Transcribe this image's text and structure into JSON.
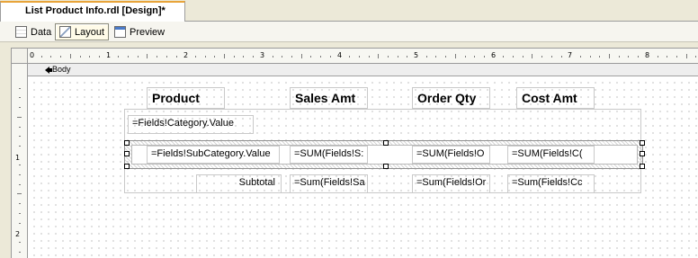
{
  "document_tab": {
    "title": "List Product Info.rdl [Design]*"
  },
  "view_tabs": [
    {
      "label": "Data",
      "icon": "data-icon"
    },
    {
      "label": "Layout",
      "icon": "layout-icon",
      "active": true
    },
    {
      "label": "Preview",
      "icon": "preview-icon"
    }
  ],
  "ruler": {
    "horizontal_labels": [
      "0",
      "1",
      "2",
      "3",
      "4",
      "5",
      "6",
      "7",
      "8"
    ],
    "vertical_labels": [
      "1",
      "2"
    ]
  },
  "section": {
    "label": "Body",
    "icon": "arrow-icon"
  },
  "report": {
    "headers": {
      "product": "Product",
      "sales_amt": "Sales Amt",
      "order_qty": "Order Qty",
      "cost_amt": "Cost Amt"
    },
    "category_field": "=Fields!Category.Value",
    "detail_row": {
      "subcategory": "=Fields!SubCategory.Value",
      "sales": "=SUM(Fields!S:",
      "order": "=SUM(Fields!O",
      "cost": "=SUM(Fields!C("
    },
    "subtotal_row": {
      "label": "Subtotal",
      "sales": "=Sum(Fields!Sa",
      "order": "=Sum(Fields!Or",
      "cost": "=Sum(Fields!Cc"
    }
  }
}
